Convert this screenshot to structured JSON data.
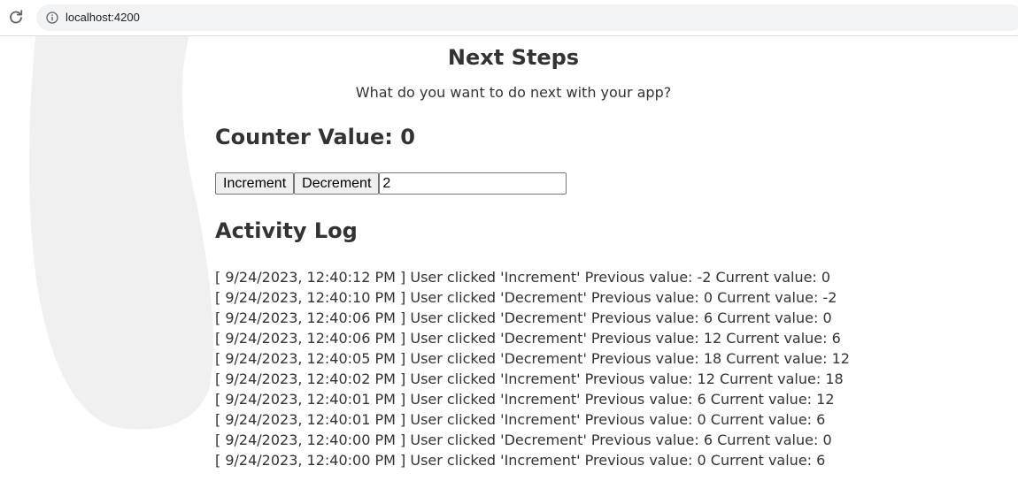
{
  "browser": {
    "url": "localhost:4200",
    "icons": {
      "reload": "reload-icon",
      "info": "info-icon"
    }
  },
  "page": {
    "title": "Next Steps",
    "subtitle": "What do you want to do next with your app?"
  },
  "counter": {
    "heading": "Counter Value: 0",
    "increment_label": "Increment",
    "decrement_label": "Decrement",
    "step_value": "2"
  },
  "activity_log": {
    "heading": "Activity Log",
    "entries": [
      "[ 9/24/2023, 12:40:12 PM ] User clicked 'Increment' Previous value: -2 Current value: 0",
      "[ 9/24/2023, 12:40:10 PM ] User clicked 'Decrement' Previous value: 0 Current value: -2",
      "[ 9/24/2023, 12:40:06 PM ] User clicked 'Decrement' Previous value: 6 Current value: 0",
      "[ 9/24/2023, 12:40:06 PM ] User clicked 'Decrement' Previous value: 12 Current value: 6",
      "[ 9/24/2023, 12:40:05 PM ] User clicked 'Decrement' Previous value: 18 Current value: 12",
      "[ 9/24/2023, 12:40:02 PM ] User clicked 'Increment' Previous value: 12 Current value: 18",
      "[ 9/24/2023, 12:40:01 PM ] User clicked 'Increment' Previous value: 6 Current value: 12",
      "[ 9/24/2023, 12:40:01 PM ] User clicked 'Increment' Previous value: 0 Current value: 6",
      "[ 9/24/2023, 12:40:00 PM ] User clicked 'Decrement' Previous value: 6 Current value: 0",
      "[ 9/24/2023, 12:40:00 PM ] User clicked 'Increment' Previous value: 0 Current value: 6"
    ]
  },
  "colors": {
    "text": "#333333",
    "background_shape": "#f0f0f0",
    "omnibox": "#f1f3f4"
  }
}
